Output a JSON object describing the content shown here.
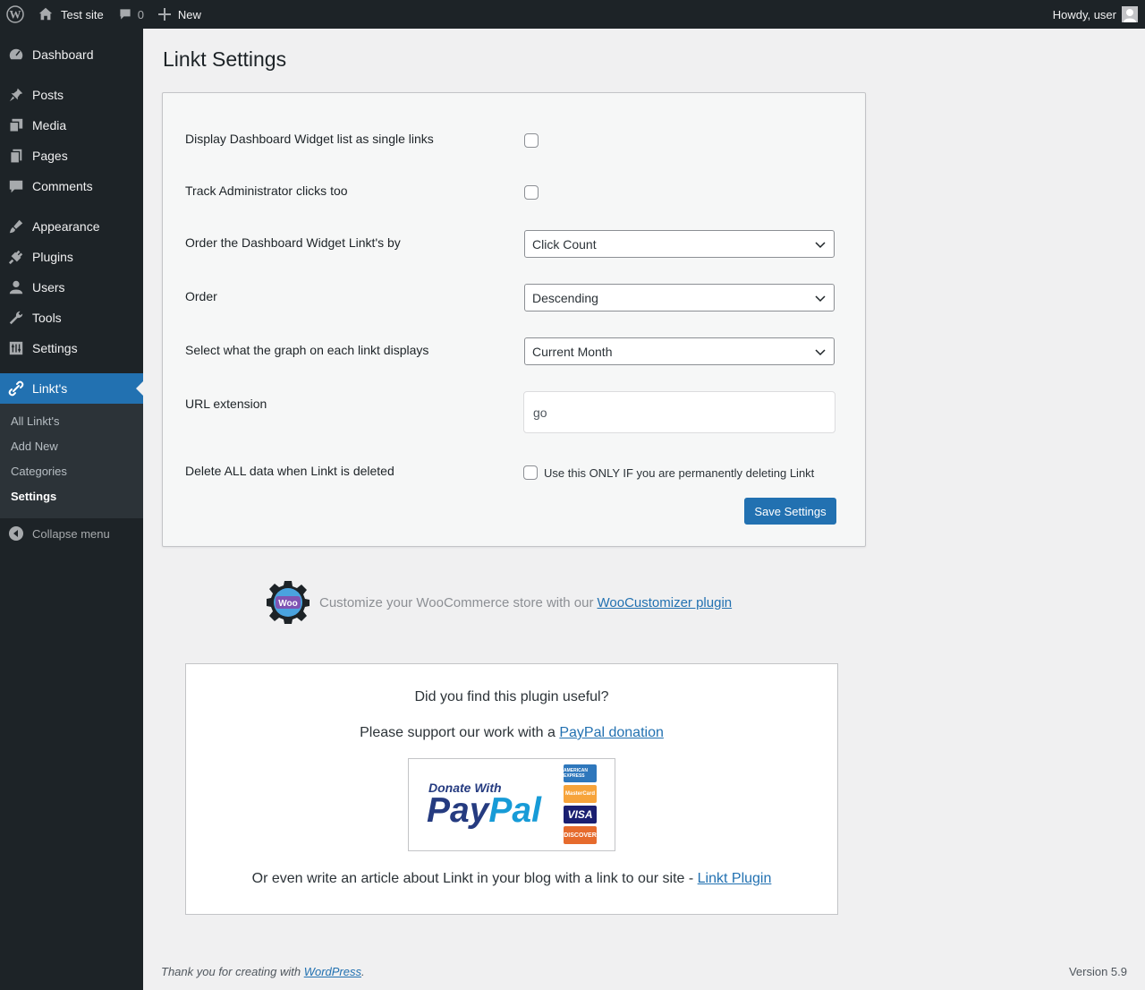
{
  "adminbar": {
    "site_name": "Test site",
    "comments_count": "0",
    "new_label": "New",
    "howdy": "Howdy, user"
  },
  "sidebar": {
    "items": [
      {
        "label": "Dashboard",
        "icon": "dashboard-icon"
      },
      {
        "label": "Posts",
        "icon": "pin-icon"
      },
      {
        "label": "Media",
        "icon": "media-icon"
      },
      {
        "label": "Pages",
        "icon": "pages-icon"
      },
      {
        "label": "Comments",
        "icon": "comment-icon"
      },
      {
        "label": "Appearance",
        "icon": "brush-icon"
      },
      {
        "label": "Plugins",
        "icon": "plug-icon"
      },
      {
        "label": "Users",
        "icon": "user-icon"
      },
      {
        "label": "Tools",
        "icon": "wrench-icon"
      },
      {
        "label": "Settings",
        "icon": "settings-icon"
      },
      {
        "label": "Linkt's",
        "icon": "paperclip-icon"
      }
    ],
    "submenu": [
      "All Linkt's",
      "Add New",
      "Categories",
      "Settings"
    ],
    "collapse_label": "Collapse menu"
  },
  "page": {
    "title": "Linkt Settings"
  },
  "settings": {
    "widget_single_links_label": "Display Dashboard Widget list as single links",
    "track_admin_label": "Track Administrator clicks too",
    "order_by_label": "Order the Dashboard Widget Linkt's by",
    "order_by_value": "Click Count",
    "order_label": "Order",
    "order_value": "Descending",
    "graph_label": "Select what the graph on each linkt displays",
    "graph_value": "Current Month",
    "url_ext_label": "URL extension",
    "url_ext_value": "go",
    "delete_label": "Delete ALL data when Linkt is deleted",
    "delete_note": "Use this ONLY IF you are permanently deleting Linkt",
    "save_label": "Save Settings"
  },
  "woo": {
    "badge": "Woo",
    "text": "Customize your WooCommerce store with our",
    "link": "WooCustomizer plugin"
  },
  "donate": {
    "question": "Did you find this plugin useful?",
    "support_text": "Please support our work with a",
    "support_link": "PayPal donation",
    "paypal_small": "Donate With",
    "paypal_pay": "Pay",
    "paypal_pal": "Pal",
    "cards": [
      "AMERICAN EXPRESS",
      "MasterCard",
      "VISA",
      "DISCOVER"
    ],
    "article_text": "Or even write an article about Linkt in your blog with a link to our site -",
    "article_link": "Linkt Plugin"
  },
  "footer": {
    "thanks": "Thank you for creating with",
    "wp_link": "WordPress",
    "period": ".",
    "version": "Version 5.9"
  }
}
